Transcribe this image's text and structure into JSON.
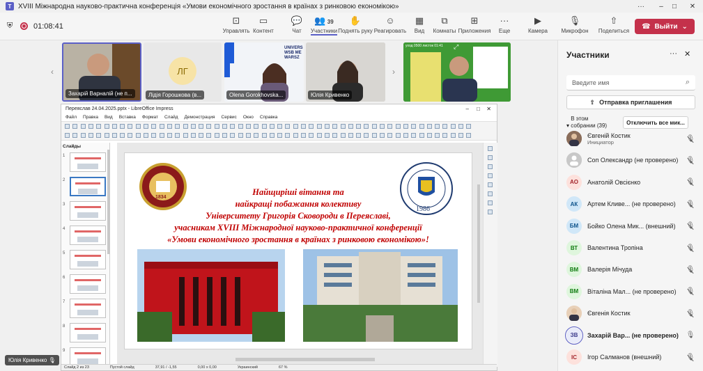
{
  "window": {
    "title": "XVIII Міжнародна науково-практична конференція «Умови економічного зростання в країнах з ринковою економікою»"
  },
  "meeting": {
    "timer": "01:08:41",
    "toolbar": [
      {
        "label": "Управлять",
        "icon": "manage-icon"
      },
      {
        "label": "Контент",
        "icon": "share-content-icon"
      },
      {
        "label": "Чат",
        "icon": "chat-icon"
      },
      {
        "label": "Участники",
        "icon": "people-icon",
        "count": "39"
      },
      {
        "label": "Поднять руку",
        "icon": "hand-icon"
      },
      {
        "label": "Реагировать",
        "icon": "smile-icon"
      },
      {
        "label": "Вид",
        "icon": "view-icon"
      },
      {
        "label": "Комнаты",
        "icon": "rooms-icon"
      },
      {
        "label": "Приложения",
        "icon": "apps-icon"
      },
      {
        "label": "Еще",
        "icon": "more-icon"
      },
      {
        "label": "Камера",
        "icon": "camera-icon"
      },
      {
        "label": "Микрофон",
        "icon": "mic-muted-icon"
      },
      {
        "label": "Поделиться",
        "icon": "share-icon"
      }
    ],
    "leave_label": "Выйти"
  },
  "tiles": [
    {
      "name": "Захарій Варналій (не п...",
      "initials": ""
    },
    {
      "name": "Лідія Горошкова (в...",
      "initials": "ЛГ"
    },
    {
      "name": "Olena Gorokhovska...",
      "initials": "",
      "bg_text": "UNIVERS WSB ME WARSZ"
    },
    {
      "name": "Юлія Кривенко",
      "initials": ""
    },
    {
      "name": "",
      "initials": "",
      "banner": "уход 0500 листок 01:41"
    }
  ],
  "lo": {
    "title": "Переяслав 24.04.2025.pptx - LibreOffice Impress",
    "menu": [
      "Файл",
      "Правка",
      "Вид",
      "Вставка",
      "Формат",
      "Слайд",
      "Демонстрация",
      "Сервис",
      "Окно",
      "Справка"
    ],
    "slides_label": "Слайды",
    "slide": {
      "lines": [
        "Найщиріші вітання та",
        "найкращі побажання колективу",
        "Університету Григорія Сковороди в Переяславі,",
        "учасникам XVIII Міжнародної науково-практичної конференції",
        "«Умови економічного зростання в країнах з ринковою економікою»!"
      ],
      "logo_year_left": "1834",
      "logo_year_right": "1986"
    },
    "status": [
      "Слайд 2 из 23",
      "Пустой слайд",
      "37,91 / -1,55",
      "0,00 x 0,00",
      "Украинский",
      "67 %"
    ]
  },
  "participants_panel": {
    "title": "Участники",
    "search_placeholder": "Введите имя",
    "invite_label": "Отправка приглашения",
    "section": "В этом собрании (39)",
    "mute_all": "Отключить все мик...",
    "people": [
      {
        "name": "Євгеній Костик",
        "sub": "Инициатор",
        "initials": "",
        "color": "#8a6d5a",
        "photo": true
      },
      {
        "name": "Соп Олександр (не проверено)",
        "initials": "",
        "color": "#c8c8c8"
      },
      {
        "name": "Анатолій Овсієнко",
        "initials": "АО",
        "color": "#fde1dc",
        "fg": "#a4262c"
      },
      {
        "name": "Артем Кливе... (не проверено)",
        "initials": "АК",
        "color": "#d0e7f8",
        "fg": "#0f548c"
      },
      {
        "name": "Бойко Олена Мик... (внешний)",
        "initials": "БМ",
        "color": "#d0e7f8",
        "fg": "#0f548c"
      },
      {
        "name": "Валентина Тропіна",
        "initials": "ВТ",
        "color": "#dff6dd",
        "fg": "#107c10"
      },
      {
        "name": "Валерія Мічуда",
        "initials": "ВМ",
        "color": "#dff6dd",
        "fg": "#107c10"
      },
      {
        "name": "Віталіна Мал... (не проверено)",
        "initials": "ВМ",
        "color": "#dff6dd",
        "fg": "#107c10"
      },
      {
        "name": "Євгенія Костик",
        "initials": "",
        "color": "#e8d0b8",
        "photo": true
      },
      {
        "name": "Захарій Вар... (не проверено)",
        "initials": "ЗВ",
        "color": "#e8ebfa",
        "fg": "#3b3a8b",
        "bold": true,
        "active": true
      },
      {
        "name": "Ігор Салманов (внешний)",
        "initials": "ІС",
        "color": "#fde1dc",
        "fg": "#a4262c"
      }
    ]
  },
  "bottom_name": "Юлія Кривенко"
}
